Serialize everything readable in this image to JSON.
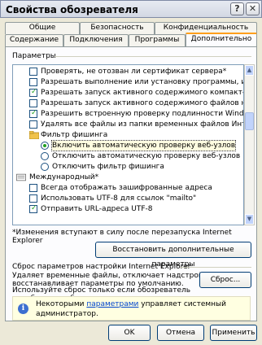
{
  "window": {
    "title": "Свойства обозревателя",
    "help_glyph": "?",
    "close_glyph": "✕"
  },
  "tabs_row1": [
    {
      "label": "Общие"
    },
    {
      "label": "Безопасность"
    },
    {
      "label": "Конфиденциальность"
    }
  ],
  "tabs_row2": [
    {
      "label": "Содержание"
    },
    {
      "label": "Подключения"
    },
    {
      "label": "Программы"
    },
    {
      "label": "Дополнительно",
      "active": true
    }
  ],
  "settings": {
    "group_label": "Параметры",
    "rows": [
      {
        "type": "checkbox",
        "checked": false,
        "text": "Проверять, не отозван ли сертификат сервера*"
      },
      {
        "type": "checkbox",
        "checked": false,
        "text": "Разрешать выполнение или установку программы, им"
      },
      {
        "type": "checkbox",
        "checked": true,
        "text": "Разрешать запуск активного содержимого компакт-ди"
      },
      {
        "type": "checkbox",
        "checked": false,
        "text": "Разрешать запуск активного содержимого файлов на"
      },
      {
        "type": "checkbox",
        "checked": true,
        "text": "Разрешить встроенную проверку подлинности Window"
      },
      {
        "type": "checkbox",
        "checked": false,
        "text": "Удалять все файлы из папки временных файлов Инте"
      },
      {
        "type": "folder",
        "text": "Фильтр фишинга"
      },
      {
        "type": "radio",
        "checked": true,
        "text": "Включить автоматическую проверку веб-узлов",
        "highlight": true
      },
      {
        "type": "radio",
        "checked": false,
        "text": "Отключить автоматическую проверку веб-узлов"
      },
      {
        "type": "radio",
        "checked": false,
        "text": "Отключить фильтр фишинга"
      },
      {
        "type": "section",
        "text": "Международный*"
      },
      {
        "type": "checkbox",
        "checked": false,
        "text": "Всегда отображать зашифрованные адреса"
      },
      {
        "type": "checkbox",
        "checked": false,
        "text": "Использовать UTF-8 для ссылок \"mailto\""
      },
      {
        "type": "checkbox",
        "checked": true,
        "text": "Отправить URL-адреса UTF-8"
      }
    ],
    "restart_note": "*Изменения вступают в силу после перезапуска Internet Explorer",
    "restore_button": "Восстановить дополнительные параметры"
  },
  "reset": {
    "group_label": "Сброс параметров настройки Internet Explorer",
    "description_line1": "Удаляет временные файлы, отключает надстройки,",
    "description_line2": "восстанавливает параметры по умолчанию.",
    "button": "Сброс...",
    "hint": "Используйте сброс только если обозреватель неработоспособен.",
    "info_prefix": "Некоторыми",
    "info_link": "параметрами",
    "info_suffix": "управляет системный",
    "info_line2": "администратор."
  },
  "footer": {
    "ok": "OK",
    "cancel": "Отмена",
    "apply": "Применить"
  }
}
